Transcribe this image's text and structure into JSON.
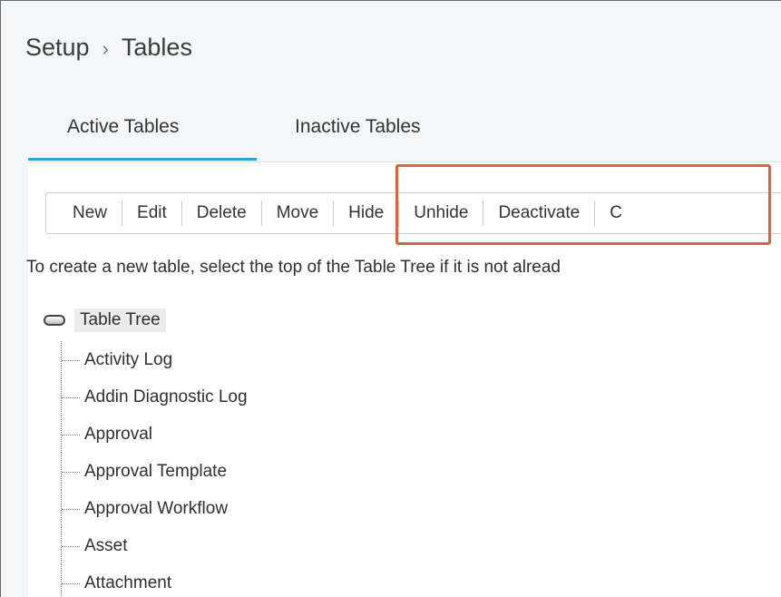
{
  "breadcrumb": {
    "root": "Setup",
    "separator": "›",
    "current": "Tables"
  },
  "tabs": [
    {
      "label": "Active Tables",
      "active": true
    },
    {
      "label": "Inactive Tables",
      "active": false
    }
  ],
  "toolbar": {
    "buttons": [
      "New",
      "Edit",
      "Delete",
      "Move",
      "Hide",
      "Unhide",
      "Deactivate",
      "C"
    ]
  },
  "instructions": "To create a new table, select the top of the Table Tree if it is not alread",
  "tree": {
    "root_label": "Table Tree",
    "items": [
      "Activity Log",
      "Addin Diagnostic Log",
      "Approval",
      "Approval Template",
      "Approval Workflow",
      "Asset",
      "Attachment"
    ]
  },
  "colors": {
    "accent": "#2ea3e0",
    "highlight": "#d9643f"
  }
}
